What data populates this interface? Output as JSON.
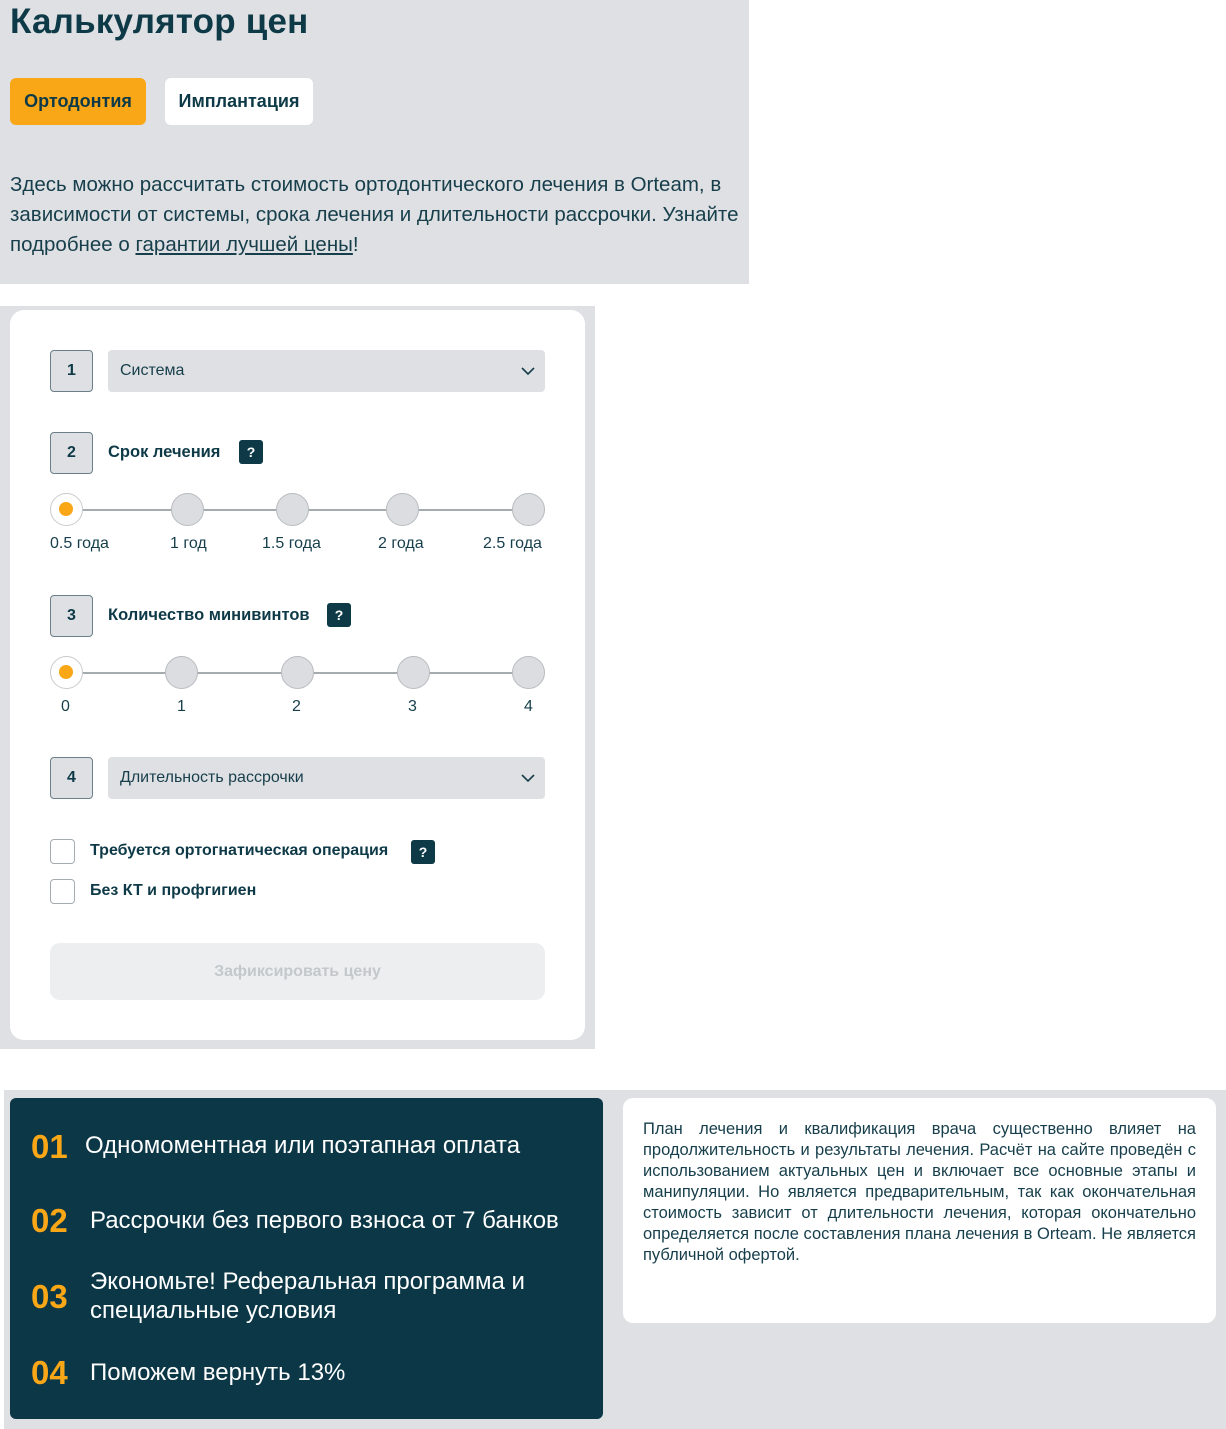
{
  "header": {
    "title": "Калькулятор цен",
    "tabs": [
      {
        "label": "Ортодонтия",
        "active": true
      },
      {
        "label": "Имплантация",
        "active": false
      }
    ],
    "intro_text": "Здесь можно рассчитать стоимость ортодонтического лечения в Orteam, в зависимости от системы, срока лечения и длительности рассрочки. Узнайте подробнее о ",
    "intro_link": "гарантии лучшей цены",
    "intro_end": "!"
  },
  "calculator": {
    "step1": {
      "number": "1",
      "select_value": "Система"
    },
    "step2": {
      "number": "2",
      "label": "Срок лечения",
      "help": "?",
      "options": [
        "0.5 года",
        "1 год",
        "1.5 года",
        "2 года",
        "2.5 года"
      ],
      "selected_index": 0
    },
    "step3": {
      "number": "3",
      "label": "Количество минивинтов",
      "help": "?",
      "options": [
        "0",
        "1",
        "2",
        "3",
        "4"
      ],
      "selected_index": 0
    },
    "step4": {
      "number": "4",
      "select_value": "Длительность рассрочки"
    },
    "checkboxes": [
      {
        "label": "Требуется ортогнатическая операция",
        "checked": false,
        "help": "?"
      },
      {
        "label": "Без КТ и профгигиен",
        "checked": false
      }
    ],
    "fix_button": "Зафиксировать цену"
  },
  "benefits": [
    {
      "num": "01",
      "text": "Одномоментная или поэтапная оплата"
    },
    {
      "num": "02",
      "text": "Рассрочки без первого взноса от 7 банков"
    },
    {
      "num": "03",
      "text": "Экономьте! Реферальная программа и специальные условия"
    },
    {
      "num": "04",
      "text": "Поможем вернуть 13%"
    }
  ],
  "note": "План лечения и квалификация врача существенно влияет на продолжительность и результаты лечения. Расчёт на сайте проведён с использованием актуальных цен и включает все основные этапы и манипуляции. Но является предварительным, так как окончательная стоимость зависит от длительности лечения, которая окончательно определяется после составления плана лечения в Orteam. Не является публичной офертой.",
  "colors": {
    "accent": "#f9a617",
    "dark": "#0b3746",
    "panel_bg": "#dfe0e3"
  }
}
